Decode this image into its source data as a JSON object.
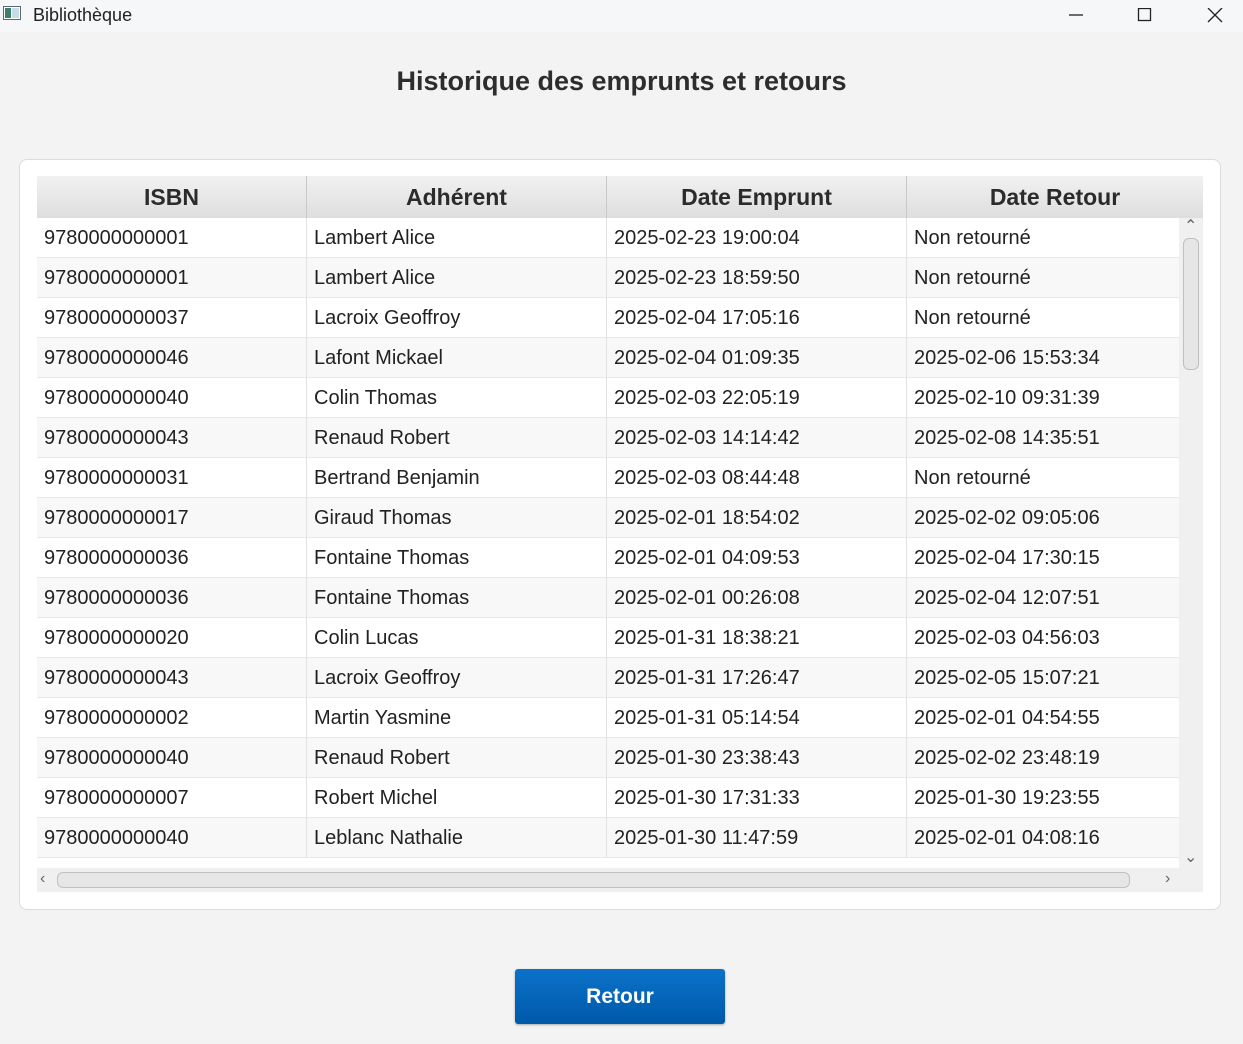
{
  "window": {
    "title": "Bibliothèque",
    "icons": [
      "app-icon",
      "minimize-icon",
      "maximize-icon",
      "close-icon"
    ]
  },
  "page": {
    "title": "Historique des emprunts et retours"
  },
  "table": {
    "columns": [
      "ISBN",
      "Adhérent",
      "Date Emprunt",
      "Date Retour"
    ],
    "rows": [
      [
        "9780000000001",
        "Lambert Alice",
        "2025-02-23 19:00:04",
        "Non retourné"
      ],
      [
        "9780000000001",
        "Lambert Alice",
        "2025-02-23 18:59:50",
        "Non retourné"
      ],
      [
        "9780000000037",
        "Lacroix Geoffroy",
        "2025-02-04 17:05:16",
        "Non retourné"
      ],
      [
        "9780000000046",
        "Lafont Mickael",
        "2025-02-04 01:09:35",
        "2025-02-06 15:53:34"
      ],
      [
        "9780000000040",
        "Colin Thomas",
        "2025-02-03 22:05:19",
        "2025-02-10 09:31:39"
      ],
      [
        "9780000000043",
        "Renaud Robert",
        "2025-02-03 14:14:42",
        "2025-02-08 14:35:51"
      ],
      [
        "9780000000031",
        "Bertrand Benjamin",
        "2025-02-03 08:44:48",
        "Non retourné"
      ],
      [
        "9780000000017",
        "Giraud Thomas",
        "2025-02-01 18:54:02",
        "2025-02-02 09:05:06"
      ],
      [
        "9780000000036",
        "Fontaine Thomas",
        "2025-02-01 04:09:53",
        "2025-02-04 17:30:15"
      ],
      [
        "9780000000036",
        "Fontaine Thomas",
        "2025-02-01 00:26:08",
        "2025-02-04 12:07:51"
      ],
      [
        "9780000000020",
        "Colin Lucas",
        "2025-01-31 18:38:21",
        "2025-02-03 04:56:03"
      ],
      [
        "9780000000043",
        "Lacroix Geoffroy",
        "2025-01-31 17:26:47",
        "2025-02-05 15:07:21"
      ],
      [
        "9780000000002",
        "Martin Yasmine",
        "2025-01-31 05:14:54",
        "2025-02-01 04:54:55"
      ],
      [
        "9780000000040",
        "Renaud Robert",
        "2025-01-30 23:38:43",
        "2025-02-02 23:48:19"
      ],
      [
        "9780000000007",
        "Robert Michel",
        "2025-01-30 17:31:33",
        "2025-01-30 19:23:55"
      ],
      [
        "9780000000040",
        "Leblanc Nathalie",
        "2025-01-30 11:47:59",
        "2025-02-01 04:08:16"
      ]
    ]
  },
  "actions": {
    "back_label": "Retour"
  },
  "colors": {
    "primary_button": "#0066bb",
    "background": "#f3f3f3"
  }
}
